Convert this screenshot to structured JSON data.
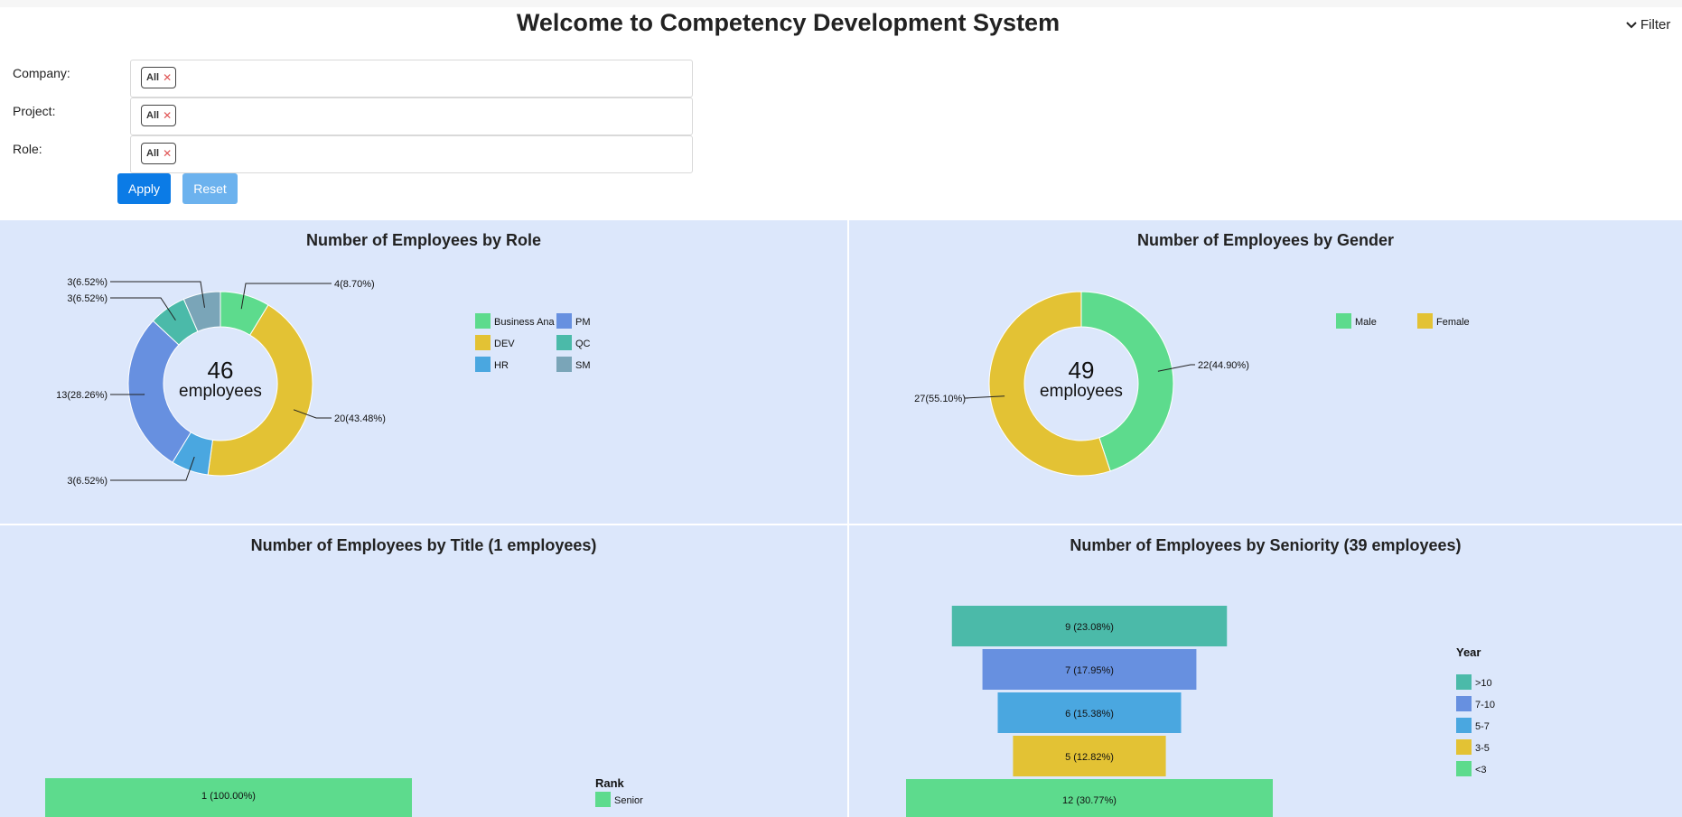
{
  "header": {
    "title": "Welcome to Competency Development System",
    "filter_label": "Filter"
  },
  "filters": [
    {
      "label": "Company:",
      "tag": "All"
    },
    {
      "label": "Project:",
      "tag": "All"
    },
    {
      "label": "Role:",
      "tag": "All"
    }
  ],
  "buttons": {
    "apply": "Apply",
    "reset": "Reset"
  },
  "icons": {
    "filter_toggle": "chevron-down-icon",
    "tag_remove": "close-icon"
  },
  "colors": {
    "accent": "#0b7be6",
    "panel_bg": "#dce7fb"
  },
  "panels": {
    "role": {
      "title": "Number of Employees by Role"
    },
    "gender": {
      "title": "Number of Employees by Gender"
    },
    "title_rank": {
      "title": "Number of Employees by Title (1 employees)"
    },
    "seniority": {
      "title": "Number of Employees by Seniority (39 employees)"
    }
  },
  "chart_data": [
    {
      "type": "pie",
      "title": "Number of Employees by Role",
      "center_value": "46",
      "center_label": "employees",
      "slices": [
        {
          "name": "Business Analyst",
          "value": 4,
          "label": "4(8.70%)",
          "color": "#5ddb8d"
        },
        {
          "name": "DEV",
          "value": 20,
          "label": "20(43.48%)",
          "color": "#e3c234"
        },
        {
          "name": "HR",
          "value": 3,
          "label": "3(6.52%)",
          "color": "#4aa7e0"
        },
        {
          "name": "PM",
          "value": 13,
          "label": "13(28.26%)",
          "color": "#6790e0"
        },
        {
          "name": "QC",
          "value": 3,
          "label": "3(6.52%)",
          "color": "#4bbaa9"
        },
        {
          "name": "SM",
          "value": 3,
          "label": "3(6.52%)",
          "color": "#7aa5b8"
        }
      ],
      "legend": [
        "Business Ana",
        "DEV",
        "HR",
        "PM",
        "QC",
        "SM"
      ],
      "legend_position": "right"
    },
    {
      "type": "pie",
      "title": "Number of Employees by Gender",
      "center_value": "49",
      "center_label": "employees",
      "slices": [
        {
          "name": "Male",
          "value": 22,
          "label": "22(44.90%)",
          "color": "#5ddb8d"
        },
        {
          "name": "Female",
          "value": 27,
          "label": "27(55.10%)",
          "color": "#e3c234"
        }
      ],
      "legend": [
        "Male",
        "Female"
      ],
      "legend_position": "top-right"
    },
    {
      "type": "bar",
      "title": "Number of Employees by Title (1 employees)",
      "legend_title": "Rank",
      "bars": [
        {
          "name": "Senior",
          "value": 1,
          "label": "1 (100.00%)",
          "color": "#5ddb8d"
        }
      ],
      "legend": [
        "Senior"
      ]
    },
    {
      "type": "bar",
      "title": "Number of Employees by Seniority (39 employees)",
      "legend_title": "Year",
      "bars": [
        {
          "name": ">10",
          "value": 9,
          "label": "9 (23.08%)",
          "color": "#4bbaa9"
        },
        {
          "name": "7-10",
          "value": 7,
          "label": "7 (17.95%)",
          "color": "#6790e0"
        },
        {
          "name": "5-7",
          "value": 6,
          "label": "6 (15.38%)",
          "color": "#4aa7e0"
        },
        {
          "name": "3-5",
          "value": 5,
          "label": "5 (12.82%)",
          "color": "#e3c234"
        },
        {
          "name": "<3",
          "value": 12,
          "label": "12 (30.77%)",
          "color": "#5ddb8d"
        }
      ],
      "legend": [
        ">10",
        "7-10",
        "5-7",
        "3-5",
        "<3"
      ]
    }
  ]
}
